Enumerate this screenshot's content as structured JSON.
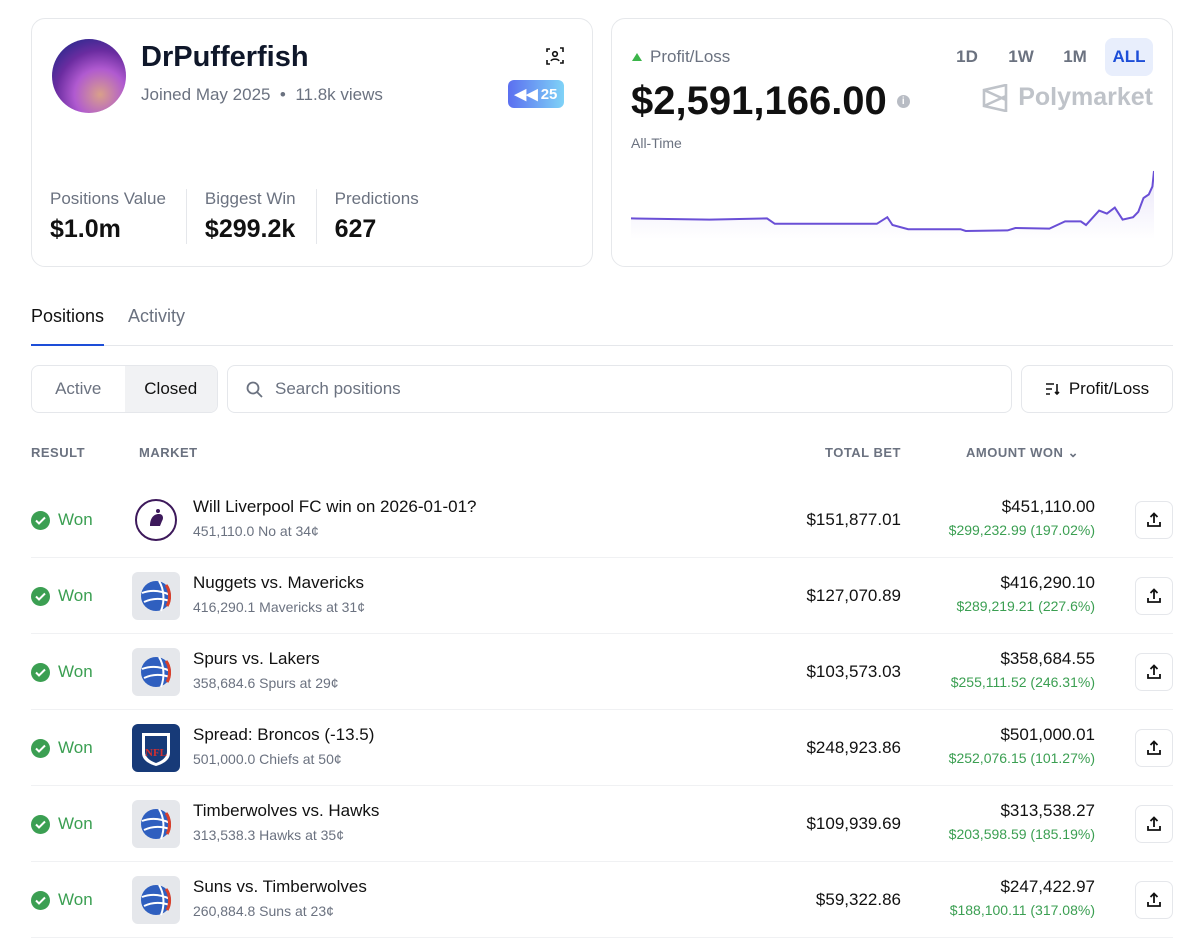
{
  "profile": {
    "name": "DrPufferfish",
    "joined": "Joined May 2025",
    "views": "11.8k views",
    "badge": "25",
    "stats": [
      {
        "label": "Positions Value",
        "value": "$1.0m"
      },
      {
        "label": "Biggest Win",
        "value": "$299.2k"
      },
      {
        "label": "Predictions",
        "value": "627"
      }
    ]
  },
  "pnl": {
    "label": "Profit/Loss",
    "amount": "$2,591,166.00",
    "period": "All-Time",
    "brand": "Polymarket",
    "ranges": [
      "1D",
      "1W",
      "1M",
      "ALL"
    ],
    "active_range": "ALL",
    "line_color": "#6a4fd6",
    "series": [
      [
        0,
        21
      ],
      [
        15,
        19
      ],
      [
        26,
        21
      ],
      [
        27.5,
        12
      ],
      [
        47,
        12
      ],
      [
        49,
        23
      ],
      [
        50,
        10
      ],
      [
        53,
        3
      ],
      [
        63,
        3
      ],
      [
        64,
        0
      ],
      [
        72,
        1
      ],
      [
        73.5,
        5
      ],
      [
        80,
        4
      ],
      [
        83,
        16
      ],
      [
        86,
        16
      ],
      [
        87,
        10
      ],
      [
        89.5,
        34
      ],
      [
        91,
        29
      ],
      [
        92.5,
        39
      ],
      [
        94,
        19
      ],
      [
        96,
        23
      ],
      [
        97,
        32
      ],
      [
        98,
        55
      ],
      [
        99,
        61
      ],
      [
        99.7,
        74
      ],
      [
        100,
        100
      ]
    ]
  },
  "tabs": [
    "Positions",
    "Activity"
  ],
  "filters": {
    "active": "Active",
    "closed": "Closed",
    "search_placeholder": "Search positions",
    "sort": "Profit/Loss"
  },
  "columns": {
    "result": "RESULT",
    "market": "MARKET",
    "total_bet": "TOTAL BET",
    "amount_won": "AMOUNT WON"
  },
  "rows": [
    {
      "result": "Won",
      "icon": "premier-league",
      "title": "Will Liverpool FC win on 2026-01-01?",
      "sub": "451,110.0 No at 34¢",
      "bet": "$151,877.01",
      "won": "$451,110.00",
      "gain": "$299,232.99 (197.02%)"
    },
    {
      "result": "Won",
      "icon": "basketball",
      "title": "Nuggets vs. Mavericks",
      "sub": "416,290.1 Mavericks at 31¢",
      "bet": "$127,070.89",
      "won": "$416,290.10",
      "gain": "$289,219.21 (227.6%)"
    },
    {
      "result": "Won",
      "icon": "basketball",
      "title": "Spurs vs. Lakers",
      "sub": "358,684.6 Spurs at 29¢",
      "bet": "$103,573.03",
      "won": "$358,684.55",
      "gain": "$255,111.52 (246.31%)"
    },
    {
      "result": "Won",
      "icon": "nfl",
      "title": "Spread: Broncos (-13.5)",
      "sub": "501,000.0 Chiefs at 50¢",
      "bet": "$248,923.86",
      "won": "$501,000.01",
      "gain": "$252,076.15 (101.27%)"
    },
    {
      "result": "Won",
      "icon": "basketball",
      "title": "Timberwolves vs. Hawks",
      "sub": "313,538.3 Hawks at 35¢",
      "bet": "$109,939.69",
      "won": "$313,538.27",
      "gain": "$203,598.59 (185.19%)"
    },
    {
      "result": "Won",
      "icon": "basketball",
      "title": "Suns vs. Timberwolves",
      "sub": "260,884.8 Suns at 23¢",
      "bet": "$59,322.86",
      "won": "$247,422.97",
      "gain": "$188,100.11 (317.08%)"
    }
  ]
}
